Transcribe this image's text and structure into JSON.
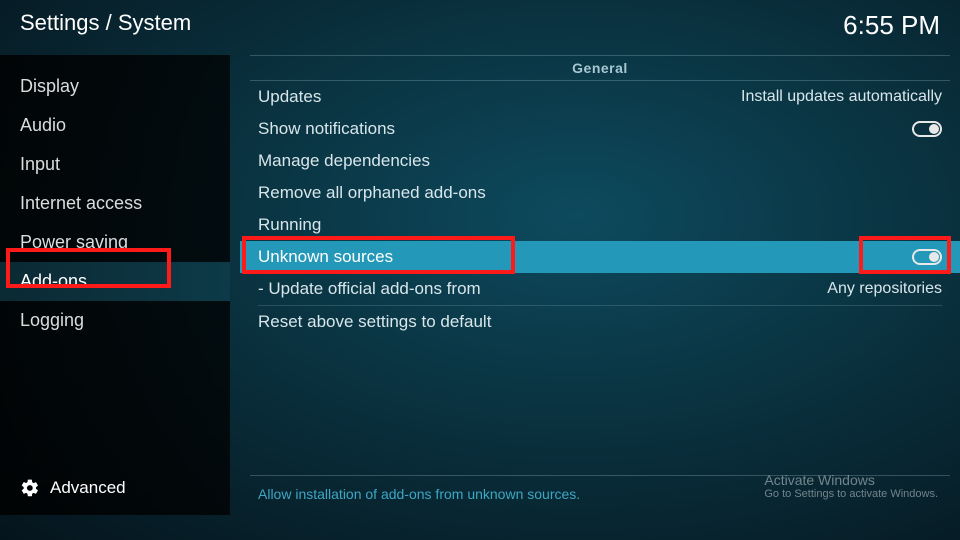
{
  "header": {
    "breadcrumb": "Settings / System",
    "clock": "6:55 PM"
  },
  "sidebar": {
    "items": [
      {
        "label": "Display"
      },
      {
        "label": "Audio"
      },
      {
        "label": "Input"
      },
      {
        "label": "Internet access"
      },
      {
        "label": "Power saving"
      },
      {
        "label": "Add-ons"
      },
      {
        "label": "Logging"
      }
    ],
    "advanced_label": "Advanced"
  },
  "content": {
    "category": "General",
    "rows": {
      "updates": {
        "label": "Updates",
        "value": "Install updates automatically"
      },
      "show_notifications": {
        "label": "Show notifications"
      },
      "manage_dependencies": {
        "label": "Manage dependencies"
      },
      "remove_orphaned": {
        "label": "Remove all orphaned add-ons"
      },
      "running": {
        "label": "Running"
      },
      "unknown_sources": {
        "label": "Unknown sources"
      },
      "update_official": {
        "label": "- Update official add-ons from",
        "value": "Any repositories"
      },
      "reset_defaults": {
        "label": "Reset above settings to default"
      }
    },
    "description": "Allow installation of add-ons from unknown sources."
  },
  "watermark": {
    "title": "Activate Windows",
    "subtitle": "Go to Settings to activate Windows."
  }
}
